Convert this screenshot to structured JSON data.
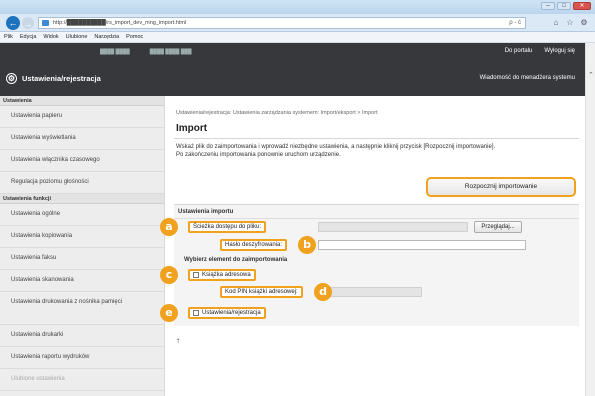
{
  "browser": {
    "url": "http://██████████/rs_import_dev_mng_import.html",
    "address_tools": "ρ - ć",
    "window_buttons": [
      "–",
      "□",
      "✕"
    ],
    "toolbar_icons": [
      "⌂",
      "☆",
      "⚙"
    ],
    "menu": [
      "Plik",
      "Edycja",
      "Widok",
      "Ulubione",
      "Narzędzia",
      "Pomoc"
    ]
  },
  "header": {
    "portal_link": "Do portalu",
    "logout_link": "Wyloguj się",
    "info_left": "████ ████",
    "info_right": "████ ████ ███",
    "brand_title": "Ustawienia/rejestracja",
    "support_link": "Wiadomość do menadżera systemu"
  },
  "sidebar": {
    "section1": "Ustawienia",
    "items1": [
      "Ustawienia papieru",
      "Ustawienia wyświetlania",
      "Ustawienia włącznika czasowego",
      "Regulacja poziomu głośności"
    ],
    "section2": "Ustawienia funkcji",
    "items2": [
      "Ustawienia ogólne",
      "Ustawienia kopiowania",
      "Ustawienia faksu",
      "Ustawienia skanowania",
      "Ustawienia drukowania z nośnika pamięci",
      "Ustawienia drukarki",
      "Ustawienia raportu wydruków",
      "Ulubione ustawienia"
    ]
  },
  "main": {
    "breadcrumb": "Ustawienia/rejestracja: Ustawienia zarządzania systemem: Import/eksport > Import",
    "title": "Import",
    "desc1": "Wskaż plik do zaimportowania i wprowadź niezbędne ustawienia, a następnie kliknij przycisk [Rozpocznij importowanie].",
    "desc2": "Po zakończeniu importowania ponownie uruchom urządzenie.",
    "start_button": "Rozpocznij importowanie",
    "import_settings_title": "Ustawienia importu",
    "file_path_label": "Ścieżka dostępu do pliku:",
    "browse_button": "Przeglądaj...",
    "password_label": "Hasło deszyfrowania:",
    "select_items_title": "Wybierz element do zaimportowania",
    "address_book_label": "Książka adresowa",
    "address_pin_label": "Kod PIN książki adresowej:",
    "settings_label": "Ustawienia/rejestracja",
    "to_top": "↑"
  },
  "badges": [
    "a",
    "b",
    "c",
    "d",
    "e"
  ],
  "colors": {
    "accent": "#f0a21e",
    "header_bg": "#36383b"
  }
}
